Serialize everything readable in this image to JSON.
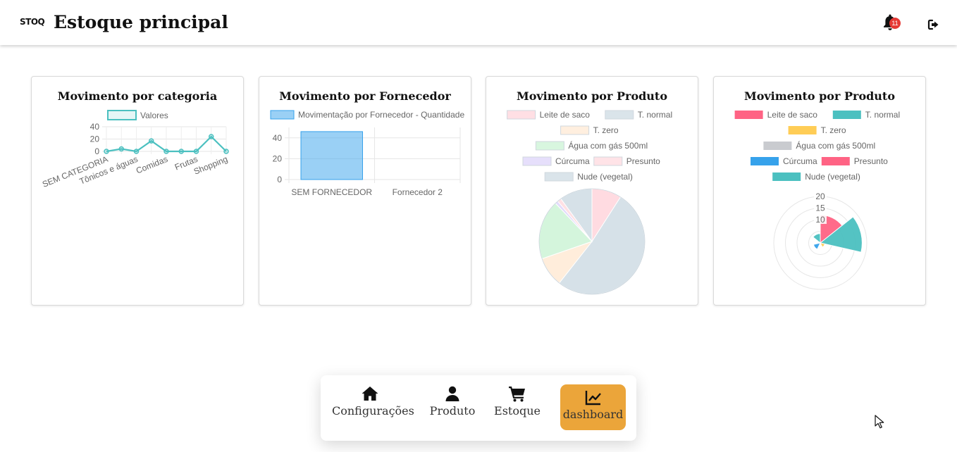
{
  "header": {
    "logo": "STOQ",
    "title": "Estoque principal",
    "notification_count": "11"
  },
  "cards": [
    {
      "title": "Movimento por categoria"
    },
    {
      "title": "Movimento por Fornecedor"
    },
    {
      "title": "Movimento por Produto"
    },
    {
      "title": "Movimento por Produto"
    }
  ],
  "chart_data": [
    {
      "type": "line",
      "title": "Movimento por categoria",
      "legend": [
        "Valores"
      ],
      "categories": [
        "SEM CATEGORIA",
        "Tônicos e águas",
        "Comidas",
        "Frutas",
        "Shopping"
      ],
      "x_points": 9,
      "series": [
        {
          "name": "Valores",
          "values": [
            0,
            4,
            0,
            17,
            0,
            0,
            0,
            24,
            0
          ]
        }
      ],
      "yticks": [
        0,
        20,
        40
      ],
      "ylim": [
        0,
        40
      ],
      "color": "#4bc0c0"
    },
    {
      "type": "bar",
      "title": "Movimento por Fornecedor",
      "legend": [
        "Movimentação por Fornecedor - Quantidade"
      ],
      "categories": [
        "SEM FORNECEDOR",
        "Fornecedor 2"
      ],
      "series": [
        {
          "name": "Movimentação por Fornecedor - Quantidade",
          "values": [
            46,
            0
          ]
        }
      ],
      "yticks": [
        0,
        20,
        40
      ],
      "ylim": [
        0,
        50
      ],
      "color": "#36a2eb"
    },
    {
      "type": "pie",
      "title": "Movimento por Produto",
      "legend": [
        "Leite de saco",
        "T. normal",
        "T. zero",
        "Água com gás 500ml",
        "Cúrcuma",
        "Presunto",
        "Nude (vegetal)"
      ],
      "values": [
        3,
        17,
        3,
        6,
        0.3,
        0.4,
        3.3
      ],
      "colors": [
        "#ffdbe1",
        "#d6e1e8",
        "#ffeddb",
        "#d4f5dc",
        "#e3dbfb",
        "#ffe0e4",
        "#d6e1e8"
      ]
    },
    {
      "type": "polarArea",
      "title": "Movimento por Produto",
      "legend": [
        "Leite de saco",
        "T. normal",
        "T. zero",
        "Água com gás 500ml",
        "Cúrcuma",
        "Presunto",
        "Nude (vegetal)"
      ],
      "values": [
        12,
        18,
        2,
        0,
        3,
        0,
        4
      ],
      "rticks": [
        20,
        15,
        10
      ],
      "rmax": 20,
      "colors": [
        "#ff6384",
        "#4bc0c0",
        "#ffcd56",
        "#c9cbcf",
        "#36a2eb",
        "#ff6384",
        "#4bc0c0"
      ]
    }
  ],
  "nav": {
    "items": [
      {
        "label": "Configurações",
        "icon": "home-icon"
      },
      {
        "label": "Produto",
        "icon": "user-icon"
      },
      {
        "label": "Estoque",
        "icon": "cart-icon"
      },
      {
        "label": "dashboard",
        "icon": "chart-line-icon"
      }
    ],
    "active_color": "#eba53a"
  }
}
